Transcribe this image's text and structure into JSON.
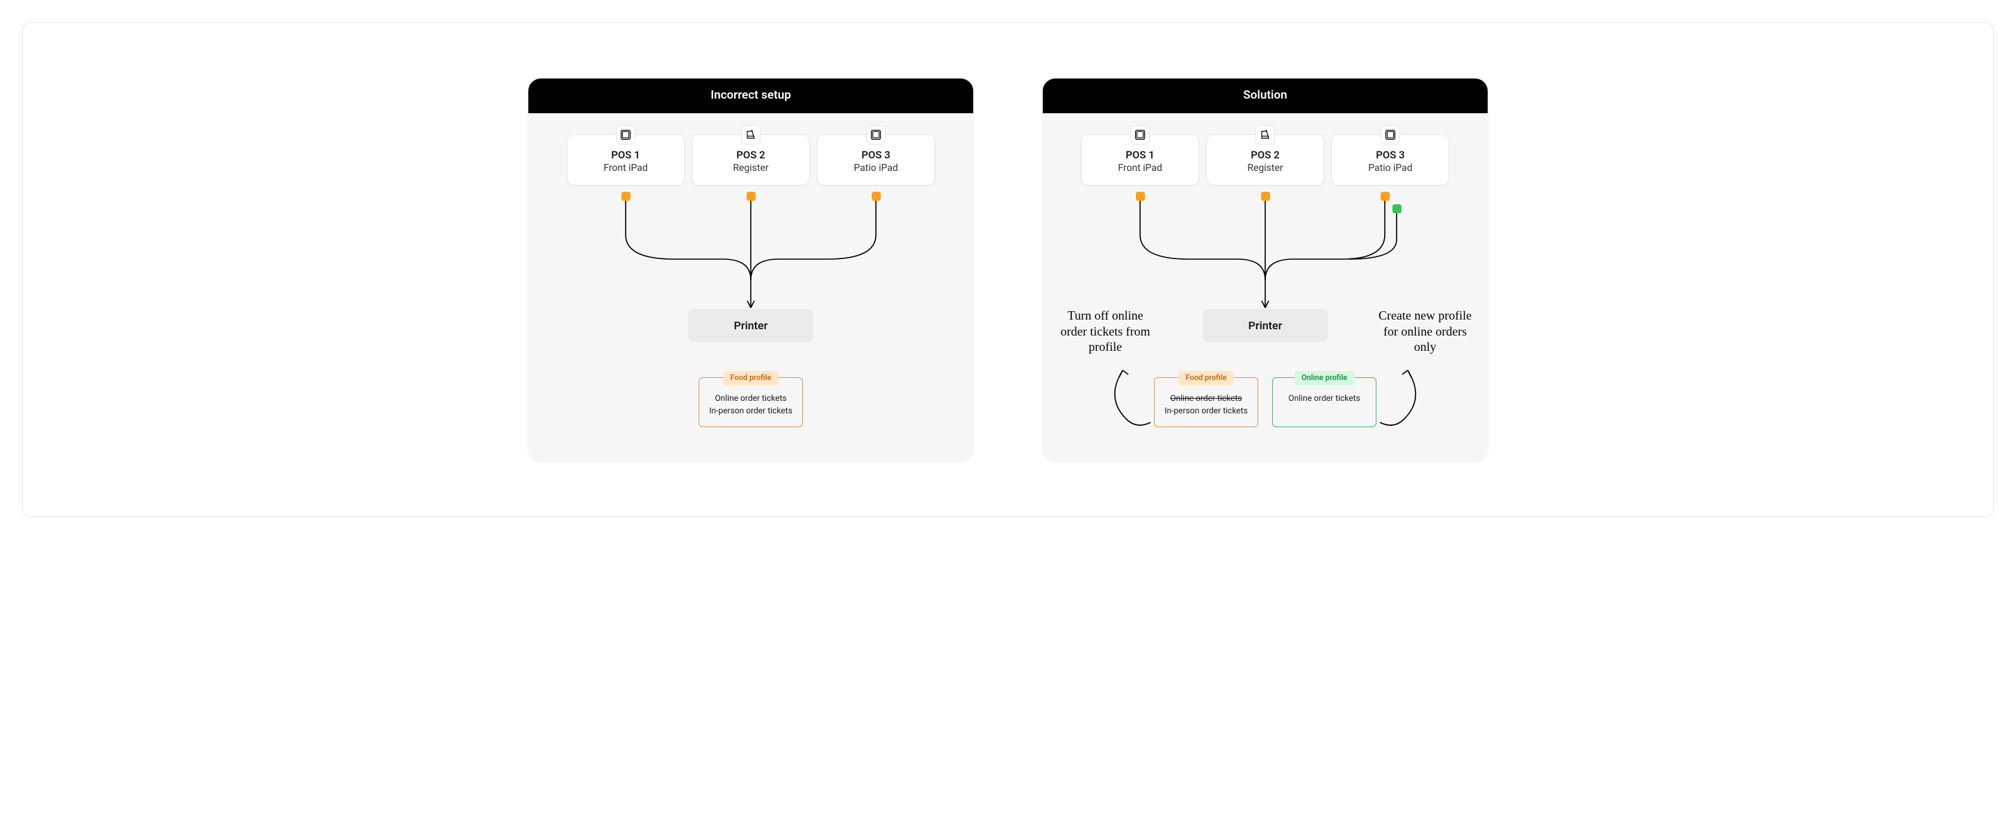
{
  "left": {
    "title": "Incorrect setup",
    "pos": [
      {
        "title": "POS 1",
        "sub": "Front iPad",
        "icon": "ipad"
      },
      {
        "title": "POS 2",
        "sub": "Register",
        "icon": "register"
      },
      {
        "title": "POS 3",
        "sub": "Patio iPad",
        "icon": "ipad"
      }
    ],
    "printer": "Printer",
    "food_profile": {
      "label": "Food profile",
      "line1": "Online order tickets",
      "line2": "In-person order tickets"
    }
  },
  "right": {
    "title": "Solution",
    "pos": [
      {
        "title": "POS 1",
        "sub": "Front iPad",
        "icon": "ipad"
      },
      {
        "title": "POS 2",
        "sub": "Register",
        "icon": "register"
      },
      {
        "title": "POS 3",
        "sub": "Patio iPad",
        "icon": "ipad"
      }
    ],
    "printer": "Printer",
    "food_profile": {
      "label": "Food profile",
      "line1": "Online order tickets",
      "line2": "In-person order tickets"
    },
    "online_profile": {
      "label": "Online profile",
      "line1": "Online order tickets"
    },
    "annot_left": "Turn off online order tickets from profile",
    "annot_right": "Create new profile for online orders only"
  },
  "colors": {
    "orange": "#ff9f1c",
    "green": "#2ec74f"
  }
}
